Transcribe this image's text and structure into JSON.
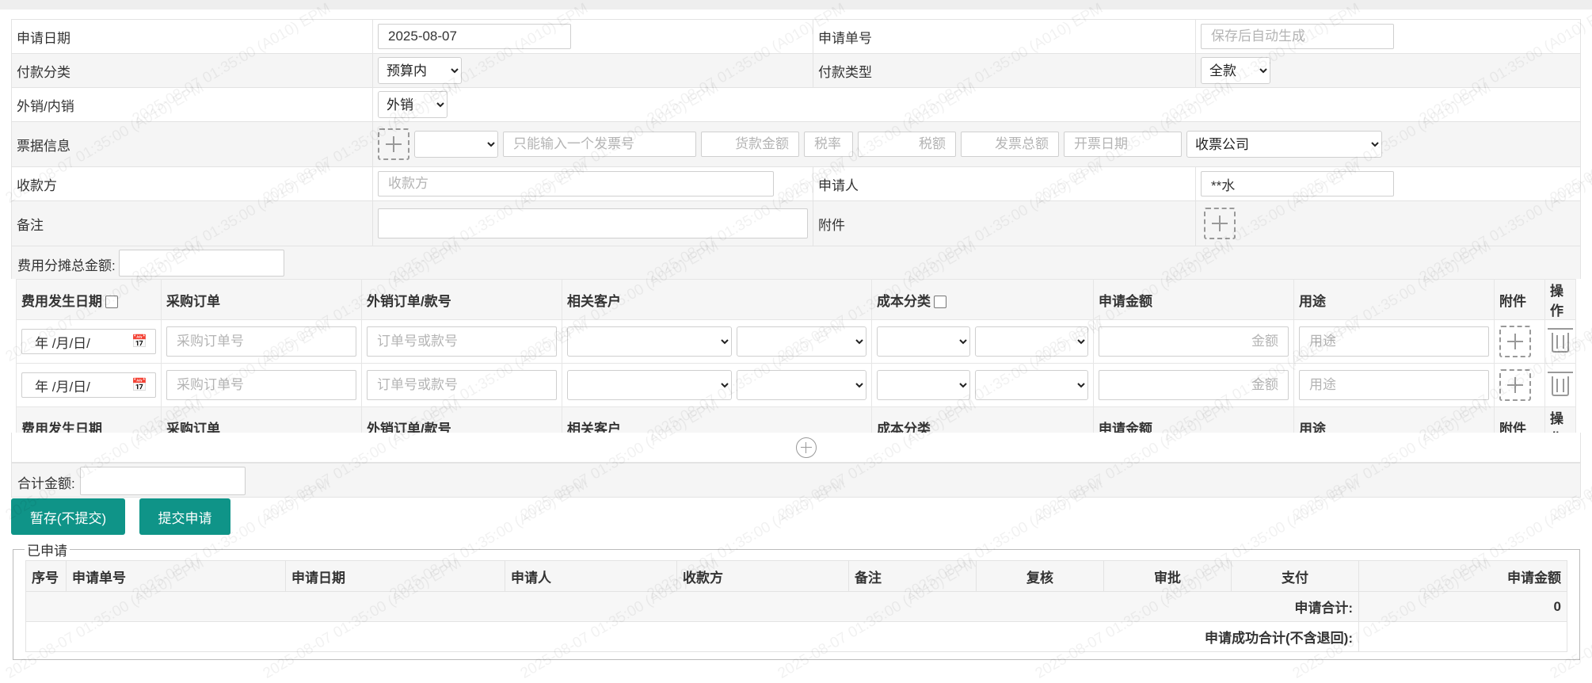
{
  "form": {
    "apply_date_label": "申请日期",
    "apply_date_value": "2025-08-07",
    "apply_no_label": "申请单号",
    "apply_no_placeholder": "保存后自动生成",
    "pay_category_label": "付款分类",
    "pay_category_value": "预算内",
    "pay_type_label": "付款类型",
    "pay_type_value": "全款",
    "sales_label": "外销/内销",
    "sales_value": "外销",
    "invoice_label": "票据信息",
    "invoice_no_placeholder": "只能输入一个发票号",
    "goods_amount_placeholder": "货款金额",
    "tax_rate_placeholder": "税率",
    "tax_amount_placeholder": "税额",
    "invoice_total_placeholder": "发票总额",
    "invoice_date_placeholder": "开票日期",
    "invoice_company_value": "收票公司",
    "payee_label": "收款方",
    "payee_placeholder": "收款方",
    "applicant_label": "申请人",
    "applicant_value": "**水",
    "remark_label": "备注",
    "attachment_label": "附件",
    "alloc_total_label": "费用分摊总金额:"
  },
  "items": {
    "headers": [
      "费用发生日期",
      "采购订单",
      "外销订单/款号",
      "相关客户",
      "成本分类",
      "申请金额",
      "用途",
      "附件",
      "操作"
    ],
    "rows": [
      {
        "date": "年 /月/日/",
        "po_placeholder": "采购订单号",
        "order_placeholder": "订单号或款号",
        "amount_placeholder": "金额",
        "use_placeholder": "用途"
      },
      {
        "date": "年 /月/日/",
        "po_placeholder": "采购订单号",
        "order_placeholder": "订单号或款号",
        "amount_placeholder": "金额",
        "use_placeholder": "用途"
      }
    ]
  },
  "total_label": "合计金额:",
  "buttons": {
    "save_draft": "暂存(不提交)",
    "submit": "提交申请"
  },
  "applied": {
    "legend": "已申请",
    "headers": [
      "序号",
      "申请单号",
      "申请日期",
      "申请人",
      "收款方",
      "备注",
      "复核",
      "审批",
      "支付",
      "申请金额"
    ],
    "sum_label": "申请合计:",
    "sum_value": "0",
    "success_sum_label": "申请成功合计(不含退回):",
    "success_sum_value": ""
  },
  "watermark": "2025-08-07 01:35:00 (A010) EPM",
  "colors": {
    "accent": "#0f9488"
  }
}
